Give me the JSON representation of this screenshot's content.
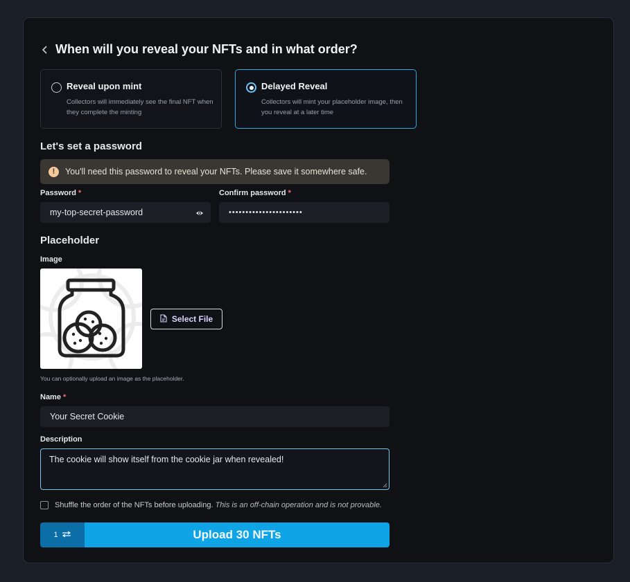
{
  "header": {
    "title": "When will you reveal your NFTs and in what order?"
  },
  "reveal_options": [
    {
      "title": "Reveal upon mint",
      "description": "Collectors will immediately see the final NFT when they complete the minting",
      "selected": false
    },
    {
      "title": "Delayed Reveal",
      "description": "Collectors will mint your placeholder image, then you reveal at a later time",
      "selected": true
    }
  ],
  "password_section": {
    "title": "Let's set a password",
    "alert": "You'll need this password to reveal your NFTs. Please save it somewhere safe.",
    "password_label": "Password",
    "password_value": "my-top-secret-password",
    "confirm_label": "Confirm password",
    "confirm_value": "••••••••••••••••••••••",
    "required_mark": "*"
  },
  "placeholder_section": {
    "title": "Placeholder",
    "image_label": "Image",
    "select_file_label": "Select File",
    "hint": "You can optionally upload an image as the placeholder.",
    "name_label": "Name",
    "name_value": "Your Secret Cookie",
    "description_label": "Description",
    "description_value": "The cookie will show itself from the cookie jar when revealed!"
  },
  "shuffle": {
    "label": "Shuffle the order of the NFTs before uploading.",
    "note": "This is an off-chain operation and is not provable.",
    "checked": false
  },
  "upload": {
    "batch_label": "1",
    "button_label": "Upload 30 NFTs"
  },
  "colors": {
    "accent": "#0ea4e6",
    "accent_dark": "#0b6ea7",
    "selected_border": "#2aa7e0",
    "warning": "#f5c99a",
    "required": "#f87171"
  }
}
